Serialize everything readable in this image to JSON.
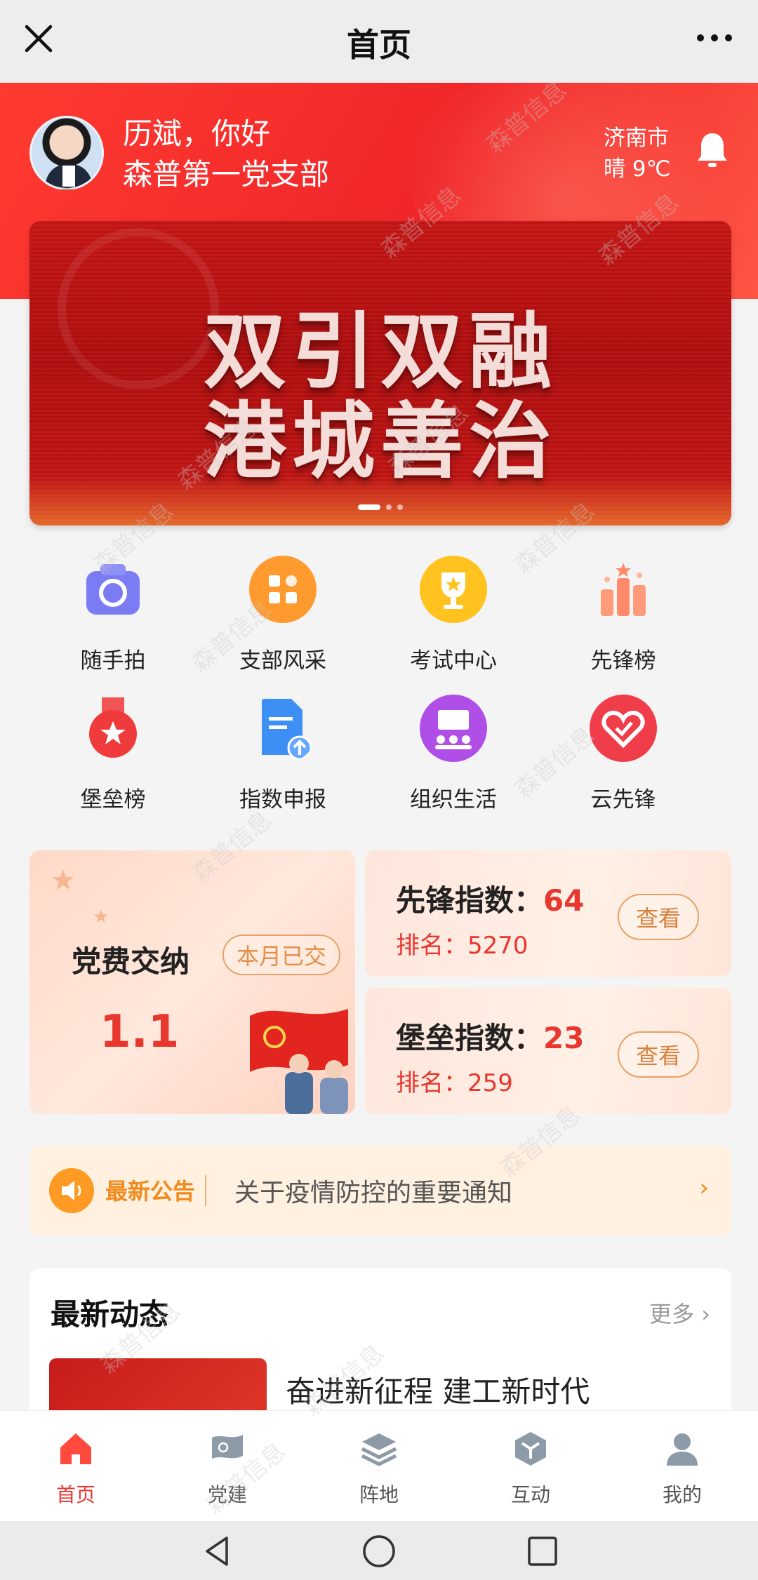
{
  "topbar": {
    "title": "首页"
  },
  "header": {
    "greeting": "历斌，你好",
    "branch": "森普第一党支部",
    "city": "济南市",
    "weather": "晴 9℃"
  },
  "banner": {
    "line1": "双引双融",
    "line2": "港城善治",
    "dots": 3,
    "active_dot": 1
  },
  "grid": [
    {
      "label": "随手拍",
      "icon": "camera-icon",
      "color": "#7b7cf4"
    },
    {
      "label": "支部风采",
      "icon": "apps-icon",
      "color": "#ff9a2e"
    },
    {
      "label": "考试中心",
      "icon": "trophy-icon",
      "color": "#ffc21f"
    },
    {
      "label": "先锋榜",
      "icon": "ranking-bars-icon",
      "color": "#ff8a6a"
    },
    {
      "label": "堡垒榜",
      "icon": "medal-icon",
      "color": "#ef3b3b"
    },
    {
      "label": "指数申报",
      "icon": "document-upload-icon",
      "color": "#3e8ff4"
    },
    {
      "label": "组织生活",
      "icon": "meeting-icon",
      "color": "#b04ee8"
    },
    {
      "label": "云先锋",
      "icon": "heart-check-icon",
      "color": "#f03d4a"
    }
  ],
  "fee_card": {
    "title": "党费交纳",
    "badge": "本月已交",
    "date": "1.1"
  },
  "pioneer_card": {
    "label": "先锋指数：",
    "value": "64",
    "rank": "排名：5270",
    "button": "查看"
  },
  "fortress_card": {
    "label": "堡垒指数：",
    "value": "23",
    "rank": "排名：259",
    "button": "查看"
  },
  "notice": {
    "tag": "最新公告",
    "text": "关于疫情防控的重要通知",
    "arrow": "›"
  },
  "news": {
    "heading": "最新动态",
    "more": "更多",
    "item_title": "奋进新征程 建工新时代"
  },
  "tabs": [
    {
      "label": "首页",
      "icon": "home-icon",
      "active": true
    },
    {
      "label": "党建",
      "icon": "party-flag-icon",
      "active": false
    },
    {
      "label": "阵地",
      "icon": "layers-icon",
      "active": false
    },
    {
      "label": "互动",
      "icon": "cube-icon",
      "active": false
    },
    {
      "label": "我的",
      "icon": "user-icon",
      "active": false
    }
  ],
  "watermark": "森普信息",
  "colors": {
    "primary_red": "#e8372f",
    "orange": "#f08a1a",
    "hero_red": "#f0262a"
  }
}
